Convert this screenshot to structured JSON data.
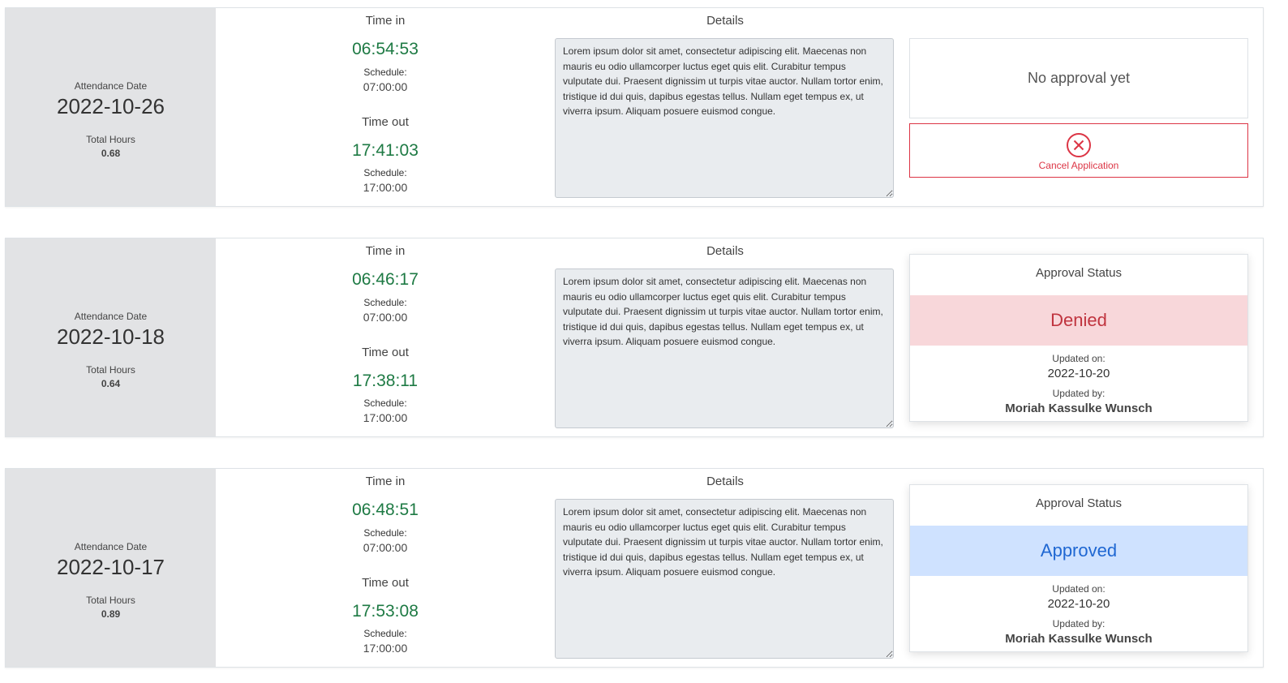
{
  "records": [
    {
      "date_label": "Attendance Date",
      "date": "2022-10-26",
      "hours_label": "Total Hours",
      "hours": "0.68",
      "time_in_label": "Time in",
      "time_in": "06:54:53",
      "schedule_label_in": "Schedule:",
      "schedule_in": "07:00:00",
      "time_out_label": "Time out",
      "time_out": "17:41:03",
      "schedule_label_out": "Schedule:",
      "schedule_out": "17:00:00",
      "details_label": "Details",
      "details": "Lorem ipsum dolor sit amet, consectetur adipiscing elit. Maecenas non mauris eu odio ullamcorper luctus eget quis elit. Curabitur tempus vulputate dui. Praesent dignissim ut turpis vitae auctor. Nullam tortor enim, tristique id dui quis, dapibus egestas tellus. Nullam eget tempus ex, ut viverra ipsum. Aliquam posuere euismod congue.",
      "approval_text": "No approval yet",
      "cancel_label": "Cancel Application"
    },
    {
      "date_label": "Attendance Date",
      "date": "2022-10-18",
      "hours_label": "Total Hours",
      "hours": "0.64",
      "time_in_label": "Time in",
      "time_in": "06:46:17",
      "schedule_label_in": "Schedule:",
      "schedule_in": "07:00:00",
      "time_out_label": "Time out",
      "time_out": "17:38:11",
      "schedule_label_out": "Schedule:",
      "schedule_out": "17:00:00",
      "details_label": "Details",
      "details": "Lorem ipsum dolor sit amet, consectetur adipiscing elit. Maecenas non mauris eu odio ullamcorper luctus eget quis elit. Curabitur tempus vulputate dui. Praesent dignissim ut turpis vitae auctor. Nullam tortor enim, tristique id dui quis, dapibus egestas tellus. Nullam eget tempus ex, ut viverra ipsum. Aliquam posuere euismod congue.",
      "status_header": "Approval Status",
      "status": "Denied",
      "updated_on_label": "Updated on:",
      "updated_on": "2022-10-20",
      "updated_by_label": "Updated by:",
      "updated_by": "Moriah Kassulke Wunsch"
    },
    {
      "date_label": "Attendance Date",
      "date": "2022-10-17",
      "hours_label": "Total Hours",
      "hours": "0.89",
      "time_in_label": "Time in",
      "time_in": "06:48:51",
      "schedule_label_in": "Schedule:",
      "schedule_in": "07:00:00",
      "time_out_label": "Time out",
      "time_out": "17:53:08",
      "schedule_label_out": "Schedule:",
      "schedule_out": "17:00:00",
      "details_label": "Details",
      "details": "Lorem ipsum dolor sit amet, consectetur adipiscing elit. Maecenas non mauris eu odio ullamcorper luctus eget quis elit. Curabitur tempus vulputate dui. Praesent dignissim ut turpis vitae auctor. Nullam tortor enim, tristique id dui quis, dapibus egestas tellus. Nullam eget tempus ex, ut viverra ipsum. Aliquam posuere euismod congue.",
      "status_header": "Approval Status",
      "status": "Approved",
      "updated_on_label": "Updated on:",
      "updated_on": "2022-10-20",
      "updated_by_label": "Updated by:",
      "updated_by": "Moriah Kassulke Wunsch"
    }
  ],
  "colors": {
    "time_green": "#1e7a44",
    "date_panel": "#e2e3e5",
    "danger": "#dc3545",
    "denied_bg": "#f8d7da",
    "approved_bg": "#cfe2ff",
    "approved_text": "#1f67d2"
  },
  "icons": {
    "cancel": "x-circle-icon"
  }
}
